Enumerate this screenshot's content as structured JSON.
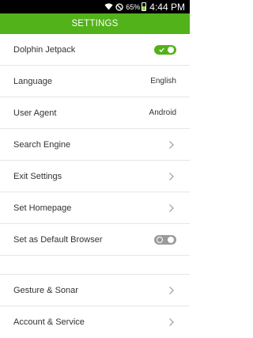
{
  "status_bar": {
    "battery_percent": "65%",
    "time": "4:44 PM",
    "icons": [
      "wifi-icon",
      "no-signal-icon",
      "battery-icon"
    ]
  },
  "header": {
    "title": "SETTINGS"
  },
  "settings": {
    "items": [
      {
        "label": "Dolphin Jetpack",
        "control": "toggle",
        "toggle_on": true
      },
      {
        "label": "Language",
        "control": "value",
        "value": "English"
      },
      {
        "label": "User Agent",
        "control": "value",
        "value": "Android"
      },
      {
        "label": "Search Engine",
        "control": "chevron"
      },
      {
        "label": "Exit Settings",
        "control": "chevron"
      },
      {
        "label": "Set Homepage",
        "control": "chevron"
      },
      {
        "label": "Set as Default Browser",
        "control": "toggle",
        "toggle_on": false
      }
    ],
    "section2": [
      {
        "label": "Gesture & Sonar",
        "control": "chevron"
      },
      {
        "label": "Account & Service",
        "control": "chevron"
      }
    ]
  },
  "colors": {
    "accent": "#52b21a",
    "toggle_off": "#9a9a9a",
    "divider": "#e6e6e6"
  }
}
